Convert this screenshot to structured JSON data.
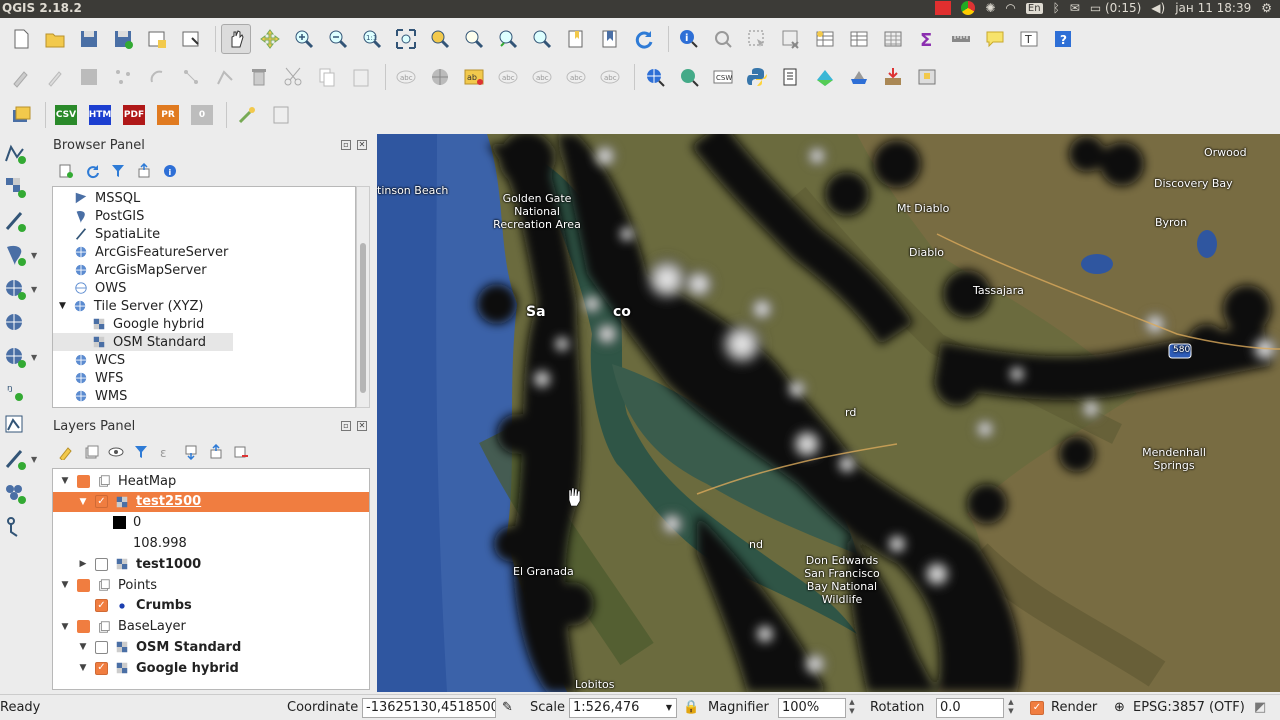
{
  "window": {
    "app_title": "QGIS 2.18.2",
    "keyboard_layout": "En",
    "battery": "(0:15)",
    "clock": "јан 11 18:39"
  },
  "toolbar_icons": {
    "row1": [
      "new-project",
      "open-project",
      "save-project",
      "save-as",
      "new-print-composer",
      "composer-manager",
      "pan",
      "pan-to-selection",
      "zoom-in",
      "zoom-out",
      "zoom-native",
      "zoom-full",
      "zoom-layer",
      "zoom-selection",
      "zoom-last",
      "zoom-next",
      "new-bookmark",
      "show-bookmarks",
      "refresh",
      "identify",
      "action",
      "select-features",
      "deselect",
      "attribute-table",
      "field-calculator",
      "statistics",
      "measure",
      "annotation",
      "text-annotation",
      "help"
    ],
    "row2": [
      "current-edits",
      "toggle-editing",
      "save-edits",
      "add-feature",
      "move-feature",
      "node-tool",
      "delete-selected",
      "cut",
      "copy",
      "paste",
      "label",
      "pin-labels",
      "show-hide-labels",
      "move-label",
      "rotate-label",
      "change-label",
      "metasearch",
      "wcs-client",
      "python-console",
      "plugin",
      "geo",
      "osm",
      "install",
      "zip"
    ],
    "row3_badges": [
      {
        "label": "CSV",
        "color": "#2a8a2a"
      },
      {
        "label": "HTM",
        "color": "#1c3fd0"
      },
      {
        "label": "PDF",
        "color": "#b01818"
      },
      {
        "label": "PR",
        "color": "#e07a20"
      },
      {
        "label": "0",
        "color": "#bdbdbd"
      }
    ]
  },
  "browser_panel": {
    "title": "Browser Panel",
    "items": [
      {
        "label": "MSSQL",
        "icon": "mssql-icon",
        "indent": 0
      },
      {
        "label": "PostGIS",
        "icon": "postgis-icon",
        "indent": 0
      },
      {
        "label": "SpatiaLite",
        "icon": "spatialite-icon",
        "indent": 0
      },
      {
        "label": "ArcGisFeatureServer",
        "icon": "globe-icon",
        "indent": 0
      },
      {
        "label": "ArcGisMapServer",
        "icon": "globe-icon",
        "indent": 0
      },
      {
        "label": "OWS",
        "icon": "ows-icon",
        "indent": 0
      },
      {
        "label": "Tile Server (XYZ)",
        "icon": "globe-icon",
        "indent": 0,
        "expanded": true
      },
      {
        "label": "Google hybrid",
        "icon": "tile-icon",
        "indent": 1
      },
      {
        "label": "OSM Standard",
        "icon": "tile-icon",
        "indent": 1,
        "highlighted": true
      },
      {
        "label": "WCS",
        "icon": "globe-icon",
        "indent": 0
      },
      {
        "label": "WFS",
        "icon": "globe-icon",
        "indent": 0
      },
      {
        "label": "WMS",
        "icon": "globe-icon",
        "indent": 0
      }
    ]
  },
  "layers_panel": {
    "title": "Layers Panel",
    "rows": [
      {
        "kind": "group",
        "label": "HeatMap",
        "checked": true,
        "expanded": true,
        "indent": 0
      },
      {
        "kind": "layer",
        "label": "test2500",
        "checked": true,
        "expanded": true,
        "indent": 1,
        "selected": true,
        "icon": "raster-icon"
      },
      {
        "kind": "legend",
        "label": "0",
        "indent": 2,
        "swatch": "#000000"
      },
      {
        "kind": "legend",
        "label": "108.998",
        "indent": 2
      },
      {
        "kind": "layer",
        "label": "test1000",
        "checked": false,
        "expanded": false,
        "indent": 1,
        "icon": "raster-icon"
      },
      {
        "kind": "group",
        "label": "Points",
        "checked": true,
        "expanded": true,
        "indent": 0
      },
      {
        "kind": "layer",
        "label": "Crumbs",
        "checked": true,
        "indent": 1,
        "icon": "point-icon",
        "no_arrow": true
      },
      {
        "kind": "group",
        "label": "BaseLayer",
        "checked": true,
        "expanded": true,
        "indent": 0
      },
      {
        "kind": "layer",
        "label": "OSM Standard",
        "checked": false,
        "expanded": true,
        "indent": 1,
        "icon": "raster-icon"
      },
      {
        "kind": "layer",
        "label": "Google hybrid",
        "checked": true,
        "expanded": true,
        "indent": 1,
        "icon": "raster-icon"
      }
    ]
  },
  "map": {
    "place_labels": [
      "tinson Beach",
      "Golden Gate National Recreation Area",
      "Sa",
      "co",
      "Mt Diablo",
      "Diablo",
      "Tassajara",
      "Orwood",
      "Discovery Bay",
      "Byron",
      "rd",
      "Mendenhall Springs",
      "El Granada",
      "Don Edwards San Francisco Bay National Wildlife",
      "nd",
      "Lobitos",
      "580"
    ]
  },
  "status_bar": {
    "state": "Ready",
    "coordinate_label": "Coordinate",
    "coordinate_value": "-13625130,4518500",
    "scale_label": "Scale",
    "scale_value": "1:526,476",
    "magnifier_label": "Magnifier",
    "magnifier_value": "100%",
    "rotation_label": "Rotation",
    "rotation_value": "0.0",
    "render_label": "Render",
    "crs_label": "EPSG:3857 (OTF)"
  }
}
